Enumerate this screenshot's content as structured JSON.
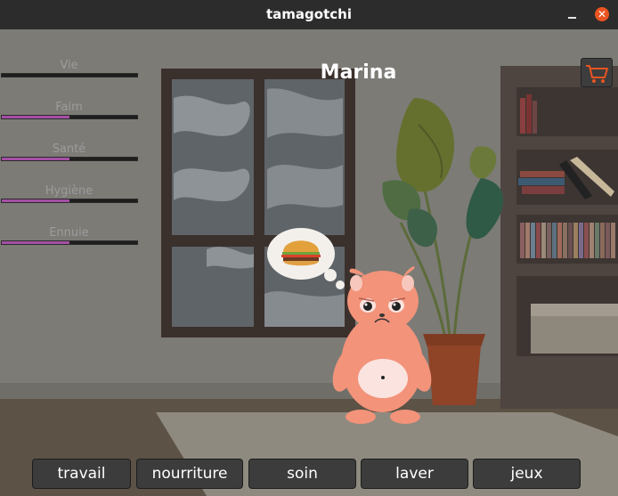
{
  "window": {
    "title": "tamagotchi",
    "close_glyph": "✕"
  },
  "pet": {
    "name": "Marina",
    "thought": "hamburger-icon",
    "mood": "sad"
  },
  "stats": [
    {
      "label": "Vie",
      "level": 0.0
    },
    {
      "label": "Faim",
      "level": 0.5
    },
    {
      "label": "Santé",
      "level": 0.5
    },
    {
      "label": "Hygiène",
      "level": 0.5
    },
    {
      "label": "Ennuie",
      "level": 0.5
    }
  ],
  "colors": {
    "stat_fill": "#a54fa6",
    "accent_orange": "#e95420",
    "pet_body": "#f2937a"
  },
  "shop": {
    "icon": "shopping-cart-icon"
  },
  "actions": [
    {
      "label": "travail"
    },
    {
      "label": "nourriture"
    },
    {
      "label": "soin"
    },
    {
      "label": "laver"
    },
    {
      "label": "jeux"
    }
  ]
}
